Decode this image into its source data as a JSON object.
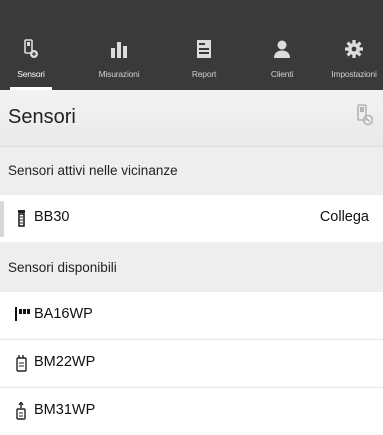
{
  "nav": {
    "tabs": [
      {
        "label": "Sensori",
        "icon": "sensor-icon",
        "active": true
      },
      {
        "label": "Misurazioni",
        "icon": "bar-chart-icon"
      },
      {
        "label": "Report",
        "icon": "report-icon"
      },
      {
        "label": "Clienti",
        "icon": "clients-icon"
      },
      {
        "label": "Impostazioni",
        "icon": "gear-icon"
      }
    ]
  },
  "header": {
    "title": "Sensori",
    "icon": "sensor-refresh-icon"
  },
  "active_section": {
    "title": "Sensori attivi nelle vicinanze",
    "items": [
      {
        "name": "BB30",
        "action": "Collega",
        "icon": "sensor-device-icon"
      }
    ]
  },
  "available_section": {
    "title": "Sensori disponibili",
    "items": [
      {
        "name": "BA16WP",
        "icon": "bar-sensor-icon"
      },
      {
        "name": "BM22WP",
        "icon": "meter-sensor-icon"
      },
      {
        "name": "BM31WP",
        "icon": "probe-sensor-icon"
      }
    ]
  },
  "colors": {
    "topbar": "#3a3a3a",
    "tab_text": "#cfcfcf",
    "active_text": "#ffffff",
    "background": "#f0f0f0"
  }
}
